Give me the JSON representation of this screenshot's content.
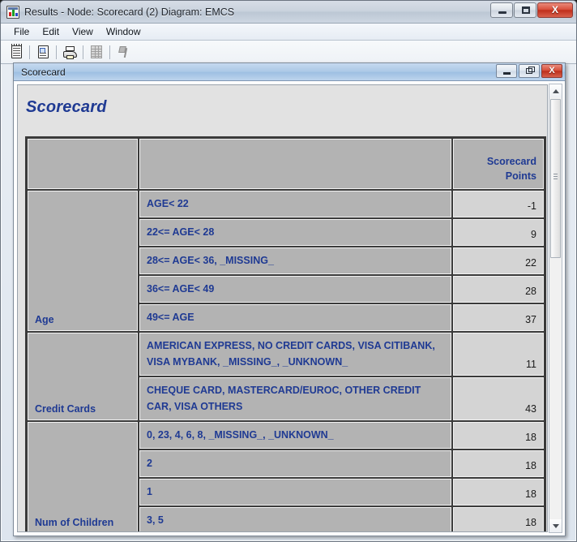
{
  "window": {
    "title": "Results - Node: Scorecard (2)  Diagram: EMCS",
    "app_icon": "results-window-icon",
    "controls": {
      "minimize": "—",
      "maximize": "□",
      "close": "X"
    }
  },
  "menu": {
    "items": [
      "File",
      "Edit",
      "View",
      "Window"
    ]
  },
  "toolbar": {
    "buttons": [
      {
        "name": "notes-icon",
        "tooltip": "Notes"
      },
      {
        "name": "report-icon",
        "tooltip": "Report"
      },
      {
        "name": "print-icon",
        "tooltip": "Print"
      },
      {
        "name": "table-icon",
        "tooltip": "Table"
      },
      {
        "name": "pin-icon",
        "tooltip": "Pin"
      }
    ]
  },
  "mdi": {
    "title": "Scorecard",
    "controls": {
      "minimize": "—",
      "restore": "❐",
      "close": "X"
    }
  },
  "document": {
    "heading": "Scorecard",
    "table": {
      "headers": [
        "",
        "",
        "Scorecard Points"
      ],
      "points_header_line1": "Scorecard",
      "points_header_line2": "Points",
      "rows": [
        {
          "category": "Age",
          "level": "AGE< 22",
          "points": "-1",
          "tall": false
        },
        {
          "category": "",
          "level": "22<= AGE< 28",
          "points": "9",
          "tall": false
        },
        {
          "category": "",
          "level": "28<= AGE< 36, _MISSING_",
          "points": "22",
          "tall": false
        },
        {
          "category": "",
          "level": "36<= AGE< 49",
          "points": "28",
          "tall": false
        },
        {
          "category": "",
          "level": "49<= AGE",
          "points": "37",
          "tall": false
        },
        {
          "category": "Credit Cards",
          "level": "AMERICAN EXPRESS, NO CREDIT CARDS, VISA CITIBANK, VISA MYBANK, _MISSING_, _UNKNOWN_",
          "points": "11",
          "tall": true
        },
        {
          "category": "",
          "level": "CHEQUE CARD, MASTERCARD/EUROC, OTHER CREDIT CAR, VISA OTHERS",
          "points": "43",
          "tall": true
        },
        {
          "category": "Num of Children",
          "level": "0, 23, 4, 6, 8, _MISSING_, _UNKNOWN_",
          "points": "18",
          "tall": false
        },
        {
          "category": "",
          "level": "2",
          "points": "18",
          "tall": false
        },
        {
          "category": "",
          "level": "1",
          "points": "18",
          "tall": false
        },
        {
          "category": "",
          "level": "3, 5",
          "points": "18",
          "tall": false
        }
      ]
    }
  },
  "scrollbar": {
    "up_arrow": "▲",
    "down_arrow": "▼"
  },
  "colors": {
    "accent_blue": "#1f3a93",
    "table_cell_bg": "#b3b3b3",
    "points_cell_bg": "#d4d4d4",
    "page_bg": "#e2e2e2"
  }
}
